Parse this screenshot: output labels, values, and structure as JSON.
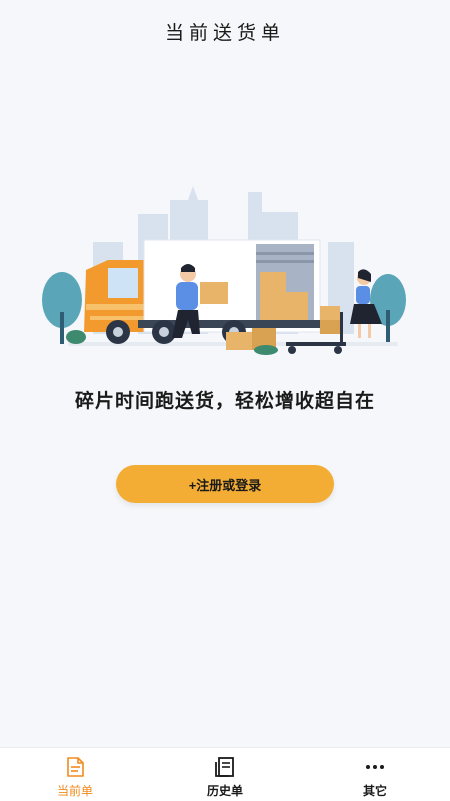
{
  "header": {
    "title": "当前送货单"
  },
  "illustration": {
    "name": "delivery-truck-illustration"
  },
  "main": {
    "slogan": "碎片时间跑送货，轻松增收超自在",
    "cta_label": "+注册或登录"
  },
  "tabbar": {
    "tabs": [
      {
        "label": "当前单",
        "icon": "document-icon",
        "active": true
      },
      {
        "label": "历史单",
        "icon": "history-icon",
        "active": false
      },
      {
        "label": "其它",
        "icon": "more-icon",
        "active": false
      }
    ]
  },
  "colors": {
    "accent": "#f3ad34",
    "active_tab": "#f08a1c",
    "background": "#f6f7fa"
  }
}
